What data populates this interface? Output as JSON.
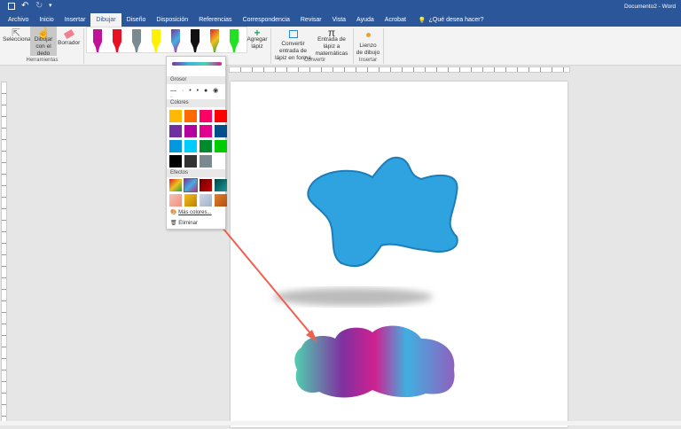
{
  "titlebar": {
    "title": "Documento2 - Word",
    "icons": [
      "save-icon",
      "undo-icon",
      "redo-icon",
      "customize-icon"
    ]
  },
  "tabs": [
    "Archivo",
    "Inicio",
    "Insertar",
    "Dibujar",
    "Diseño",
    "Disposición",
    "Referencias",
    "Correspondencia",
    "Revisar",
    "Vista",
    "Ayuda",
    "Acrobat"
  ],
  "active_tab": "Dibujar",
  "tell_me": "¿Qué desea hacer?",
  "ribbon": {
    "select": "Seleccionar",
    "draw_finger": "Dibujar con el dedo",
    "eraser": "Borrador",
    "group_tools": "Herramientas",
    "add_pen": "Agregar lápiz",
    "convert_shape": "Convertir entrada de lápiz en forma",
    "ink_math": "Entrada de lápiz a matemáticas",
    "group_convert": "Convertir",
    "canvas": "Lienzo de dibujo",
    "group_insert": "Insertar",
    "pens": [
      "#c0139a",
      "#e81123",
      "#7a8a90",
      "#fff200",
      "galaxy",
      "#111111",
      "rainbow",
      "#22e022"
    ]
  },
  "dropdown": {
    "thickness_label": "Grosor",
    "colors_label": "Colores",
    "colors": [
      "#ffb900",
      "#ff6a00",
      "#ff0066",
      "#ff0000",
      "#7030a0",
      "#b4009e",
      "#e3008c",
      "#004e8c",
      "#0099e0",
      "#00ccff",
      "#008a2e",
      "#00cc00",
      "#000000",
      "#333333",
      "#7a8a90"
    ],
    "effects_label": "Efectos",
    "effects": [
      "rainbow",
      "galaxy",
      "lava",
      "ocean",
      "rose-gold",
      "gold",
      "silver",
      "bronze"
    ],
    "more_colors": "Más colores...",
    "delete": "Eliminar"
  },
  "colors": {
    "accent": "#2b579a",
    "shape_blue": "#2fa3e0",
    "arrow": "#f06050"
  }
}
